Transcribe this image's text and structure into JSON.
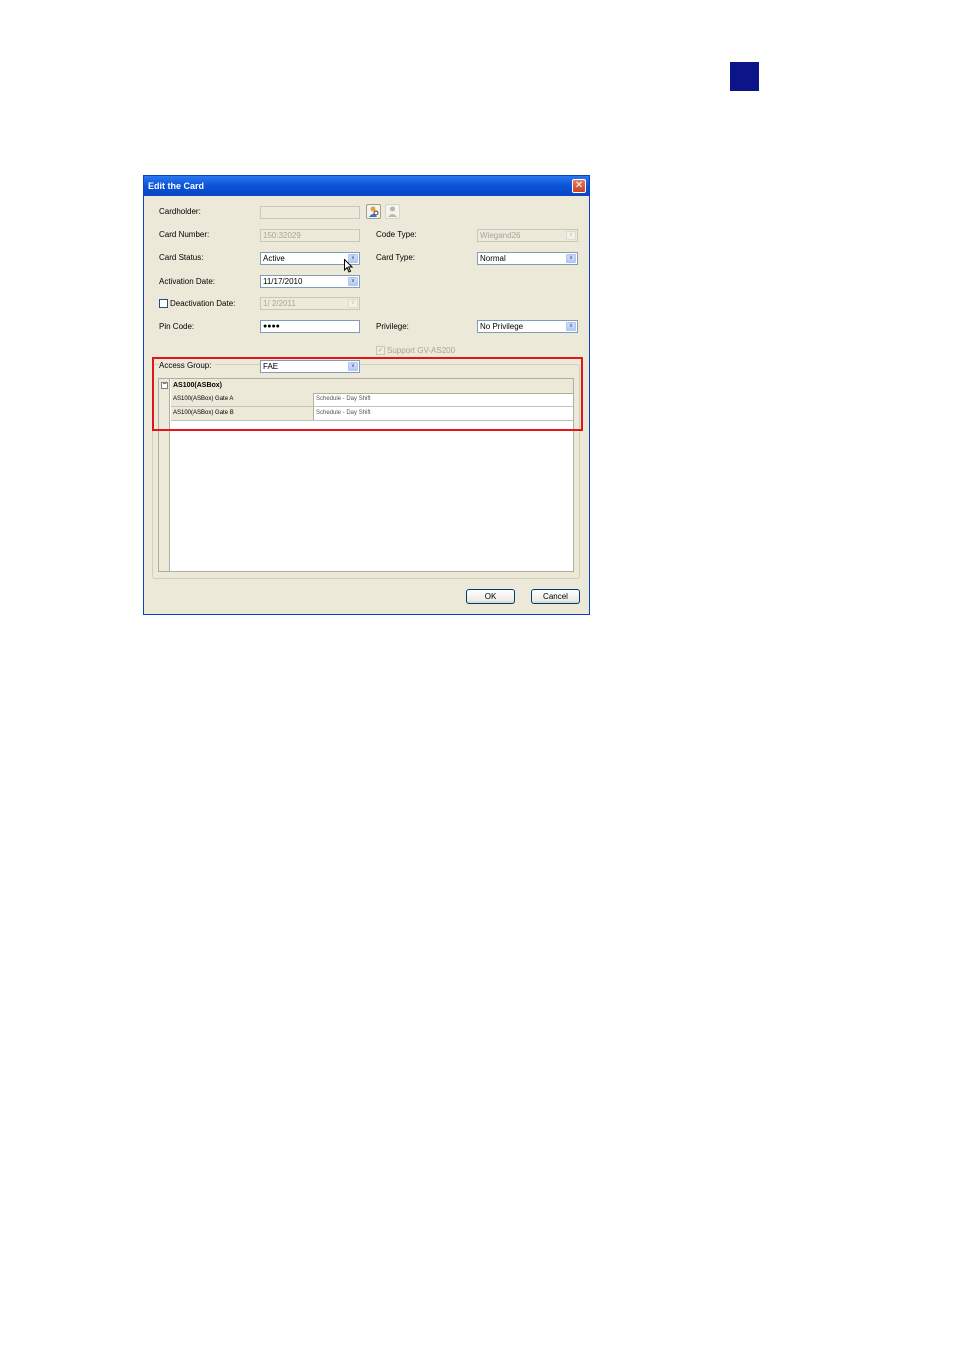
{
  "dialog": {
    "title": "Edit the Card",
    "close_glyph": "✕"
  },
  "form": {
    "cardholder_label": "Cardholder:",
    "cardholder_value": "",
    "card_number_label": "Card Number:",
    "card_number_value": "150:32029",
    "code_type_label": "Code Type:",
    "code_type_value": "Wiegand26",
    "card_status_label": "Card Status:",
    "card_status_value": "Active",
    "card_type_label": "Card Type:",
    "card_type_value": "Normal",
    "activation_date_label": "Activation Date:",
    "activation_date_value": "11/17/2010",
    "deactivation_date_label": "Deactivation Date:",
    "deactivation_date_value": "1/ 2/2011",
    "pin_code_label": "Pin Code:",
    "pin_code_value": "●●●●",
    "privilege_label": "Privilege:",
    "privilege_value": "No Privilege",
    "support_label": "Support GV-AS200",
    "access_group_label": "Access Group:",
    "access_group_value": "FAE"
  },
  "grid": {
    "group": "AS100(ASBox)",
    "rows": [
      {
        "name": "AS100(ASBox) Gate A",
        "schedule": "Schedule - Day Shift"
      },
      {
        "name": "AS100(ASBox) Gate B",
        "schedule": "Schedule - Day Shift"
      }
    ]
  },
  "buttons": {
    "ok": "OK",
    "cancel": "Cancel"
  },
  "colors": {
    "page_badge": "#0b1489",
    "highlight": "#e3141b",
    "title_bar": "#0b52d8"
  }
}
